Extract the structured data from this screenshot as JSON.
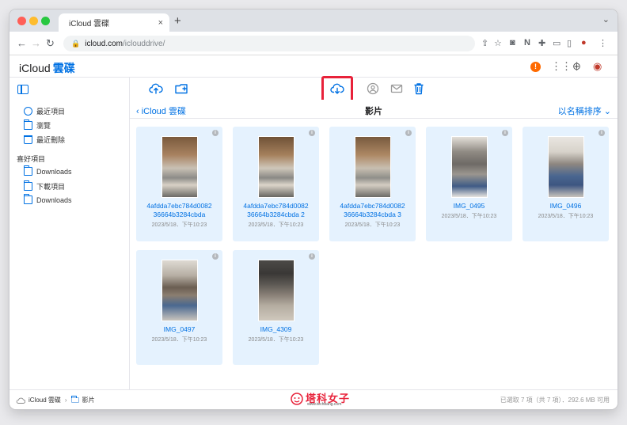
{
  "browser": {
    "tab_title": "iCloud 雲碟",
    "url_host": "icloud.com",
    "url_path": "/iclouddrive/"
  },
  "app": {
    "brand_name": "iCloud",
    "brand_suffix": "雲碟",
    "alert_badge": "!"
  },
  "sidebar": {
    "recents": "最近項目",
    "browse": "瀏覽",
    "recently_deleted": "最近刪除",
    "favorites_header": "喜好項目",
    "favorites": [
      "Downloads",
      "下載項目",
      "Downloads"
    ]
  },
  "crumb": {
    "back_label": "iCloud 雲碟",
    "title": "影片",
    "sort_label": "以名稱排序"
  },
  "files": [
    {
      "name": "4afdda7ebc784d0082 36664b3284cbda",
      "date": "2023/5/18．下午10:23"
    },
    {
      "name": "4afdda7ebc784d0082 36664b3284cbda 2",
      "date": "2023/5/18．下午10:23"
    },
    {
      "name": "4afdda7ebc784d0082 36664b3284cbda 3",
      "date": "2023/5/18．下午10:23"
    },
    {
      "name": "IMG_0495",
      "date": "2023/5/18．下午10:23"
    },
    {
      "name": "IMG_0496",
      "date": "2023/5/18．下午10:23"
    },
    {
      "name": "IMG_0497",
      "date": "2023/5/18．下午10:23"
    },
    {
      "name": "IMG_4309",
      "date": "2023/5/18．下午10:23"
    }
  ],
  "status": {
    "path_root": "iCloud 雲碟",
    "path_current": "影片",
    "summary": "已選取 7 項（共 7 項）．292.6 MB 可用"
  },
  "watermark": {
    "text": "塔科女子",
    "sub": "www.techbang.com"
  },
  "colors": {
    "accent": "#0071e3",
    "card_bg": "#e5f2fe",
    "highlight": "#e8223a"
  }
}
